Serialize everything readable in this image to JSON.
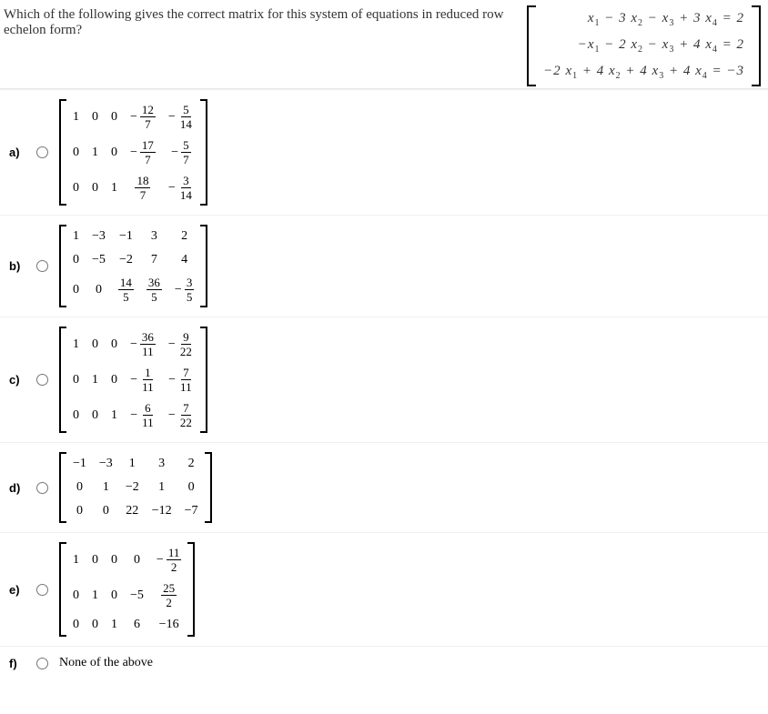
{
  "question": "Which of the following gives the correct matrix for this system of equations in reduced row echelon form?",
  "equations": [
    "x₁ − 3 x₂ − x₃ + 3 x₄ = 2",
    "−x₁ − 2 x₂ − x₃ + 4 x₄ = 2",
    "−2 x₁ + 4 x₂ + 4 x₃ + 4 x₄ = −3"
  ],
  "options": {
    "a": {
      "label": "a)"
    },
    "b": {
      "label": "b)"
    },
    "c": {
      "label": "c)"
    },
    "d": {
      "label": "d)"
    },
    "e": {
      "label": "e)"
    },
    "f": {
      "label": "f)",
      "text": "None of the above"
    }
  },
  "matrices": {
    "a": [
      [
        "1",
        "0",
        "0",
        {
          "neg": true,
          "frac": [
            "12",
            "7"
          ]
        },
        {
          "neg": true,
          "frac": [
            "5",
            "14"
          ]
        }
      ],
      [
        "0",
        "1",
        "0",
        {
          "neg": true,
          "frac": [
            "17",
            "7"
          ]
        },
        {
          "neg": true,
          "frac": [
            "5",
            "7"
          ]
        }
      ],
      [
        "0",
        "0",
        "1",
        {
          "frac": [
            "18",
            "7"
          ]
        },
        {
          "neg": true,
          "frac": [
            "3",
            "14"
          ]
        }
      ]
    ],
    "b": [
      [
        "1",
        "−3",
        "−1",
        "3",
        "2"
      ],
      [
        "0",
        "−5",
        "−2",
        "7",
        "4"
      ],
      [
        "0",
        "0",
        {
          "frac": [
            "14",
            "5"
          ]
        },
        {
          "frac": [
            "36",
            "5"
          ]
        },
        {
          "neg": true,
          "frac": [
            "3",
            "5"
          ]
        }
      ]
    ],
    "c": [
      [
        "1",
        "0",
        "0",
        {
          "neg": true,
          "frac": [
            "36",
            "11"
          ]
        },
        {
          "neg": true,
          "frac": [
            "9",
            "22"
          ]
        }
      ],
      [
        "0",
        "1",
        "0",
        {
          "neg": true,
          "frac": [
            "1",
            "11"
          ]
        },
        {
          "neg": true,
          "frac": [
            "7",
            "11"
          ]
        }
      ],
      [
        "0",
        "0",
        "1",
        {
          "neg": true,
          "frac": [
            "6",
            "11"
          ]
        },
        {
          "neg": true,
          "frac": [
            "7",
            "22"
          ]
        }
      ]
    ],
    "d": [
      [
        "−1",
        "−3",
        "1",
        "3",
        "2"
      ],
      [
        "0",
        "1",
        "−2",
        "1",
        "0"
      ],
      [
        "0",
        "0",
        "22",
        "−12",
        "−7"
      ]
    ],
    "e": [
      [
        "1",
        "0",
        "0",
        "0",
        {
          "neg": true,
          "frac": [
            "11",
            "2"
          ]
        }
      ],
      [
        "0",
        "1",
        "0",
        "−5",
        {
          "frac": [
            "25",
            "2"
          ]
        }
      ],
      [
        "0",
        "0",
        "1",
        "6",
        "−16"
      ]
    ]
  }
}
